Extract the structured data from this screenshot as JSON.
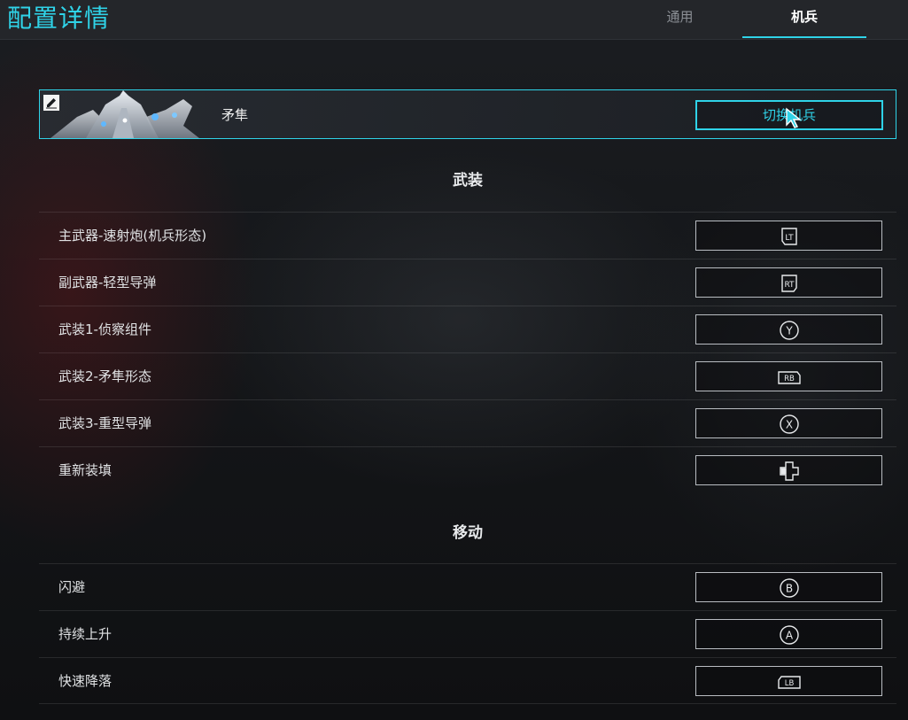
{
  "header": {
    "title": "配置详情",
    "tabs": [
      {
        "label": "通用",
        "active": false
      },
      {
        "label": "机兵",
        "active": true
      }
    ],
    "accent_color": "#2fd3e8"
  },
  "mech": {
    "name": "矛隼",
    "switch_label": "切换机兵",
    "edit_icon": "edit-icon"
  },
  "sections": [
    {
      "title": "武装",
      "rows": [
        {
          "label": "主武器-速射炮(机兵形态)",
          "button": "LT"
        },
        {
          "label": "副武器-轻型导弹",
          "button": "RT"
        },
        {
          "label": "武装1-侦察组件",
          "button": "Y"
        },
        {
          "label": "武装2-矛隼形态",
          "button": "RB"
        },
        {
          "label": "武装3-重型导弹",
          "button": "X"
        },
        {
          "label": "重新装填",
          "button": "dpad-left-icon"
        }
      ]
    },
    {
      "title": "移动",
      "rows": [
        {
          "label": "闪避",
          "button": "B"
        },
        {
          "label": "持续上升",
          "button": "A"
        },
        {
          "label": "快速降落",
          "button": "LB"
        }
      ]
    }
  ]
}
